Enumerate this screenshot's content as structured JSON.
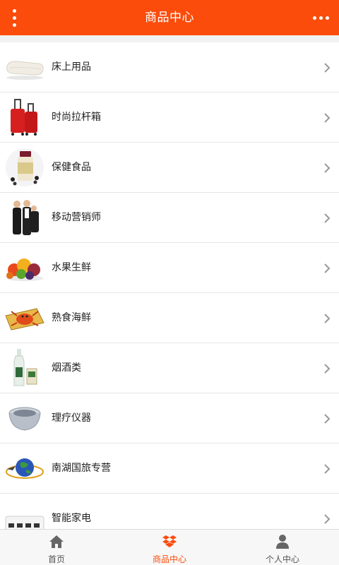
{
  "header": {
    "title": "商品中心",
    "menu_icon": "menu-dots-vertical-icon",
    "more_icon": "more-dots-horizontal-icon",
    "background": "#fb4c0c"
  },
  "items": [
    {
      "label": "床上用品",
      "icon": "pillow-icon"
    },
    {
      "label": "时尚拉杆箱",
      "icon": "luggage-icon"
    },
    {
      "label": "保健食品",
      "icon": "supplement-bottle-icon"
    },
    {
      "label": "移动营销师",
      "icon": "business-people-icon"
    },
    {
      "label": "水果生鲜",
      "icon": "fruit-icon"
    },
    {
      "label": "熟食海鲜",
      "icon": "crab-icon"
    },
    {
      "label": "烟酒类",
      "icon": "liquor-bottle-icon"
    },
    {
      "label": "理疗仪器",
      "icon": "therapy-device-icon"
    },
    {
      "label": "南湖国旅专营",
      "icon": "globe-travel-icon"
    },
    {
      "label": "智能家电",
      "icon": "appliance-icon"
    }
  ],
  "tabbar": [
    {
      "label": "首页",
      "icon": "home-icon",
      "active": false
    },
    {
      "label": "商品中心",
      "icon": "box-icon",
      "active": true
    },
    {
      "label": "个人中心",
      "icon": "user-icon",
      "active": false
    }
  ],
  "colors": {
    "accent": "#fb4c0c",
    "divider": "#e6e6e6",
    "chevron": "#999999"
  }
}
